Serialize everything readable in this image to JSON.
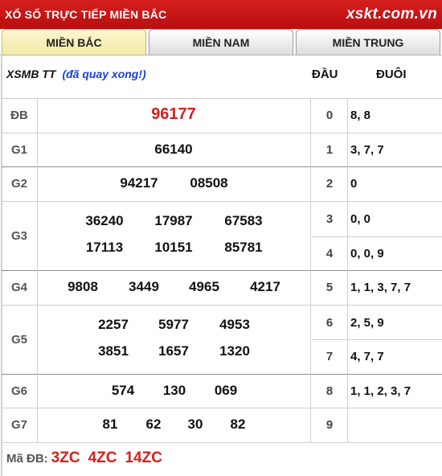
{
  "header": {
    "title": "XỔ SỐ TRỰC TIẾP MIỀN BẮC",
    "brand": "xskt.com.vn"
  },
  "tabs": [
    {
      "label": "MIỀN BẮC",
      "active": true
    },
    {
      "label": "MIỀN NAM",
      "active": false
    },
    {
      "label": "MIỀN TRUNG",
      "active": false
    }
  ],
  "table": {
    "heading": "XSMB TT",
    "status": "(đã quay xong!)",
    "col_dau": "ĐẦU",
    "col_duoi": "ĐUÔI",
    "prizes": {
      "db": {
        "label": "ĐB",
        "numbers": [
          "96177"
        ]
      },
      "g1": {
        "label": "G1",
        "numbers": [
          "66140"
        ]
      },
      "g2": {
        "label": "G2",
        "numbers": [
          "94217",
          "08508"
        ]
      },
      "g3": {
        "label": "G3",
        "numbers": [
          "36240",
          "17987",
          "67583",
          "17113",
          "10151",
          "85781"
        ]
      },
      "g4": {
        "label": "G4",
        "numbers": [
          "9808",
          "3449",
          "4965",
          "4217"
        ]
      },
      "g5": {
        "label": "G5",
        "numbers": [
          "2257",
          "5977",
          "4953",
          "3851",
          "1657",
          "1320"
        ]
      },
      "g6": {
        "label": "G6",
        "numbers": [
          "574",
          "130",
          "069"
        ]
      },
      "g7": {
        "label": "G7",
        "numbers": [
          "81",
          "62",
          "30",
          "82"
        ]
      }
    },
    "loto": [
      {
        "dau": "0",
        "duoi": "8, 8"
      },
      {
        "dau": "1",
        "duoi": "3, 7, 7"
      },
      {
        "dau": "2",
        "duoi": "0"
      },
      {
        "dau": "3",
        "duoi": "0, 0"
      },
      {
        "dau": "4",
        "duoi": "0, 0, 9"
      },
      {
        "dau": "5",
        "duoi": "1, 1, 3, 7, 7"
      },
      {
        "dau": "6",
        "duoi": "2, 5, 9"
      },
      {
        "dau": "7",
        "duoi": "4, 7, 7"
      },
      {
        "dau": "8",
        "duoi": "1, 1, 2, 3, 7"
      },
      {
        "dau": "9",
        "duoi": ""
      }
    ]
  },
  "footer": {
    "label": "Mã ĐB:",
    "codes": [
      "3ZC",
      "4ZC",
      "14ZC"
    ]
  },
  "colors": {
    "header_red": "#c41616",
    "special_red": "#d21f1f",
    "status_blue": "#1a3fd6",
    "active_tab": "#f3e9a7"
  }
}
